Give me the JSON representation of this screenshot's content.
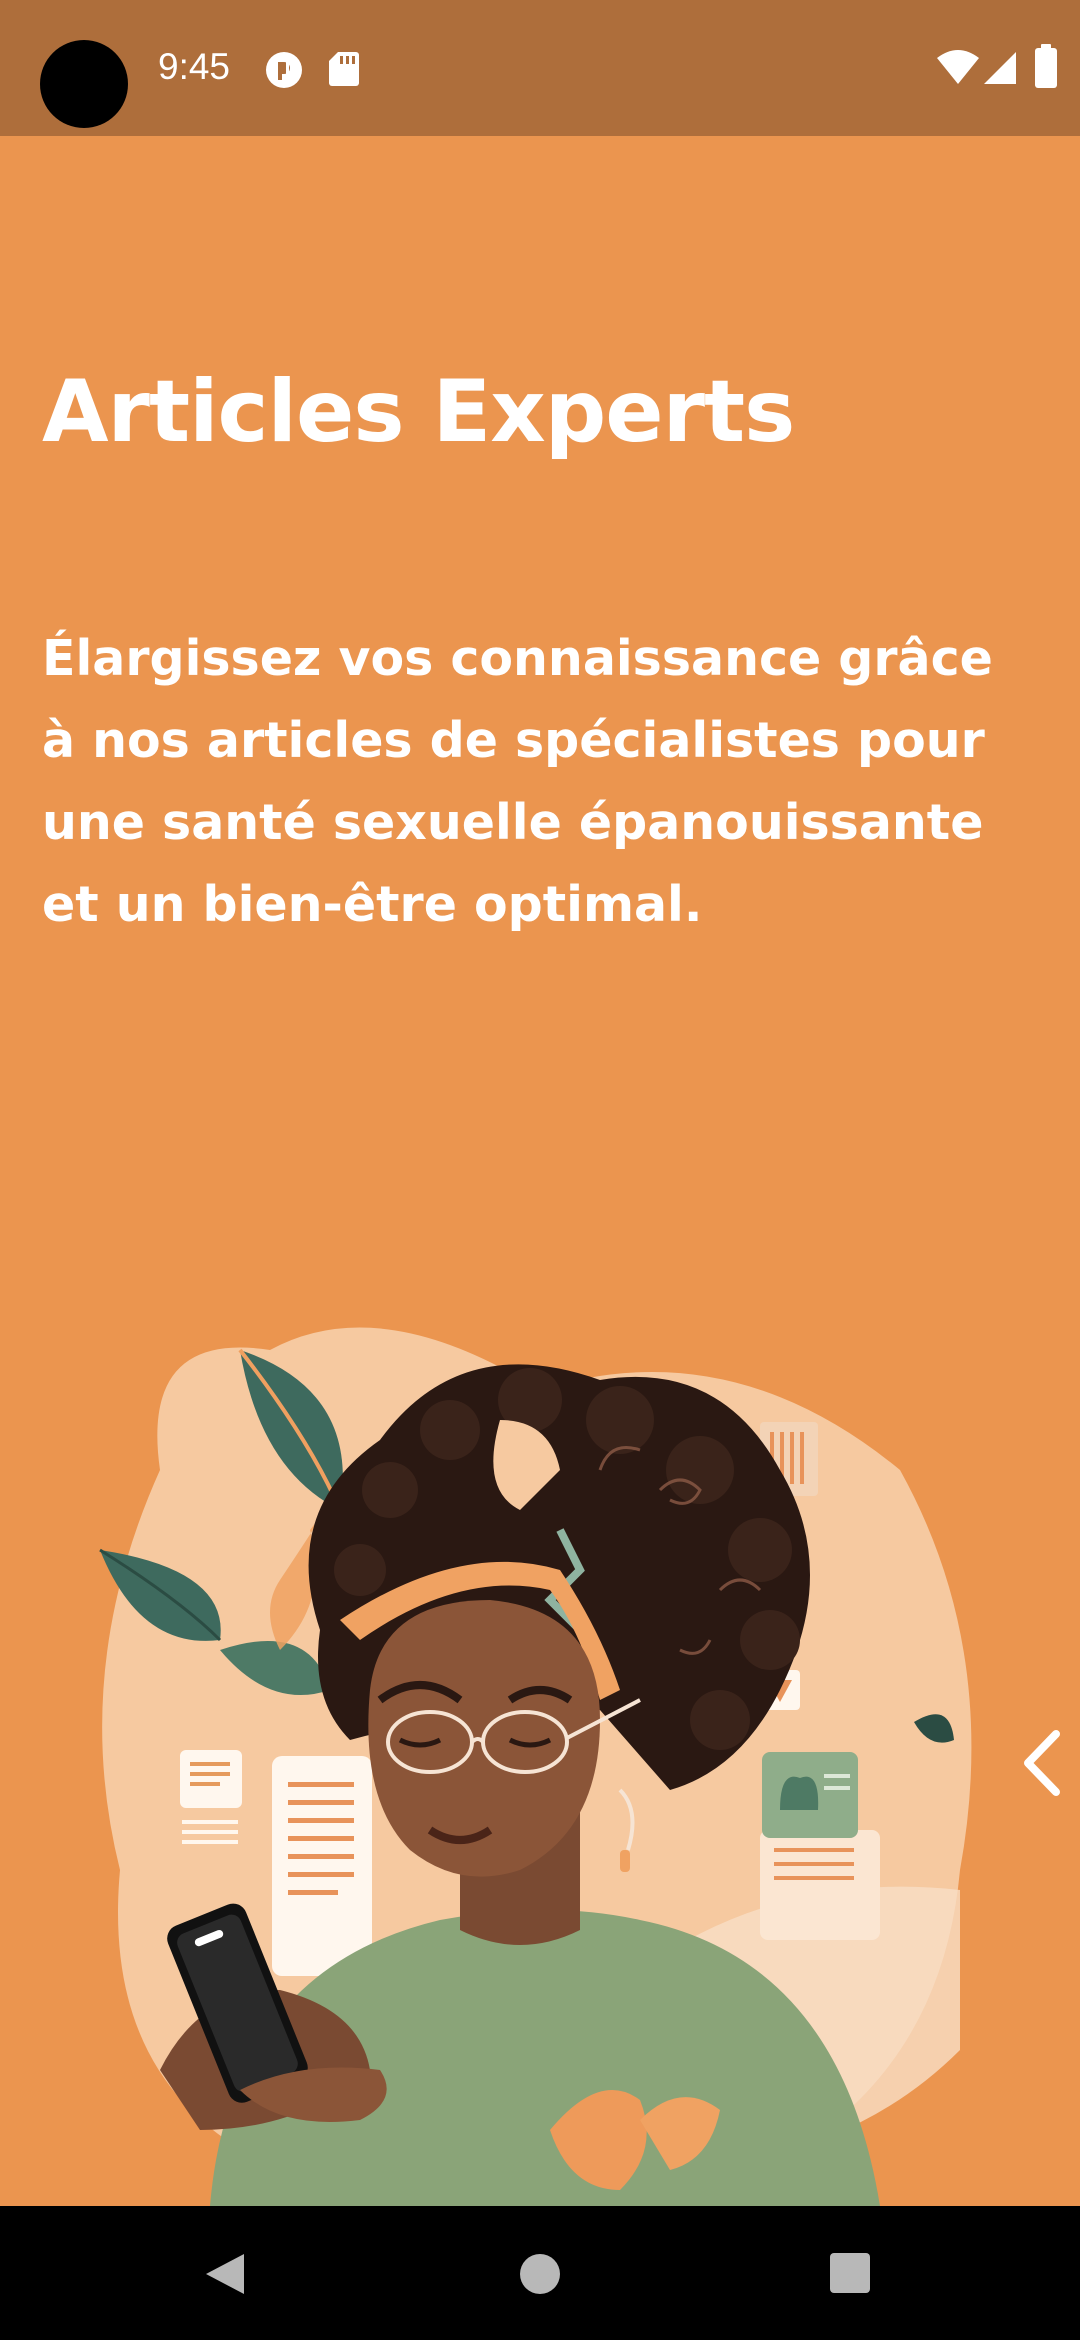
{
  "status_bar": {
    "time": "9:45",
    "icons": [
      "notification-app-icon",
      "sd-card-icon",
      "wifi-icon",
      "cellular-signal-icon",
      "battery-icon"
    ]
  },
  "onboarding": {
    "title": "Articles Experts",
    "description": "Élargissez vos connaissance grâce à nos articles de spécialistes pour une santé sexuelle épanouissante et un bien-être optimal.",
    "illustration": "woman-reading-phone-illustration",
    "navigation_icon": "chevron-left-icon"
  },
  "nav_bar": {
    "buttons": [
      "back-triangle-icon",
      "home-circle-icon",
      "recents-square-icon"
    ]
  },
  "colors": {
    "background": "#EB954F",
    "status_bar": "#AE6E3B",
    "text": "#FFFFFF",
    "nav_bar": "#000000"
  }
}
